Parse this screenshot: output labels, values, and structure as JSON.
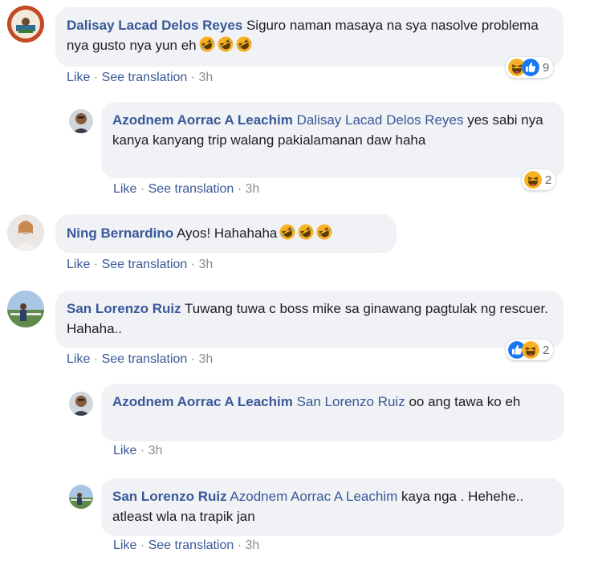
{
  "actions": {
    "like": "Like",
    "see_translation": "See translation",
    "sep": " · "
  },
  "comments": [
    {
      "author": "Dalisay Lacad Delos Reyes",
      "mention": "",
      "text": "Siguro naman masaya na sya nasolve problema nya gusto nya yun eh",
      "time": "3h",
      "reaction_count": "9",
      "emoji_count": 3
    },
    {
      "author": "Azodnem Aorrac A Leachim",
      "mention": "Dalisay Lacad Delos Reyes",
      "text": "yes sabi nya kanya kanyang trip walang pakialamanan daw haha",
      "time": "3h",
      "reaction_count": "2"
    },
    {
      "author": "Ning Bernardino",
      "mention": "",
      "text": "Ayos! Hahahaha",
      "time": "3h",
      "emoji_count": 3
    },
    {
      "author": "San Lorenzo Ruiz",
      "mention": "",
      "text": "Tuwang tuwa c boss mike sa ginawang pagtulak ng rescuer. Hahaha..",
      "time": "3h",
      "reaction_count": "2"
    },
    {
      "author": "Azodnem Aorrac A Leachim",
      "mention": "San Lorenzo Ruiz",
      "text": "oo ang tawa ko eh",
      "time": "3h"
    },
    {
      "author": "San Lorenzo Ruiz",
      "mention": "Azodnem Aorrac A Leachim",
      "text": "kaya nga . Hehehe.. atleast wla na trapik jan",
      "time": "3h"
    }
  ],
  "colors": {
    "name": "#385898",
    "bubble": "#f0f2f5",
    "meta": "#8a8d91",
    "like_blue": "#1877f2",
    "haha_yellow": "#f7b125"
  },
  "icons": {
    "haha": "haha-reaction-icon",
    "like": "like-reaction-icon",
    "rofl": "rolling-laughing-emoji"
  }
}
